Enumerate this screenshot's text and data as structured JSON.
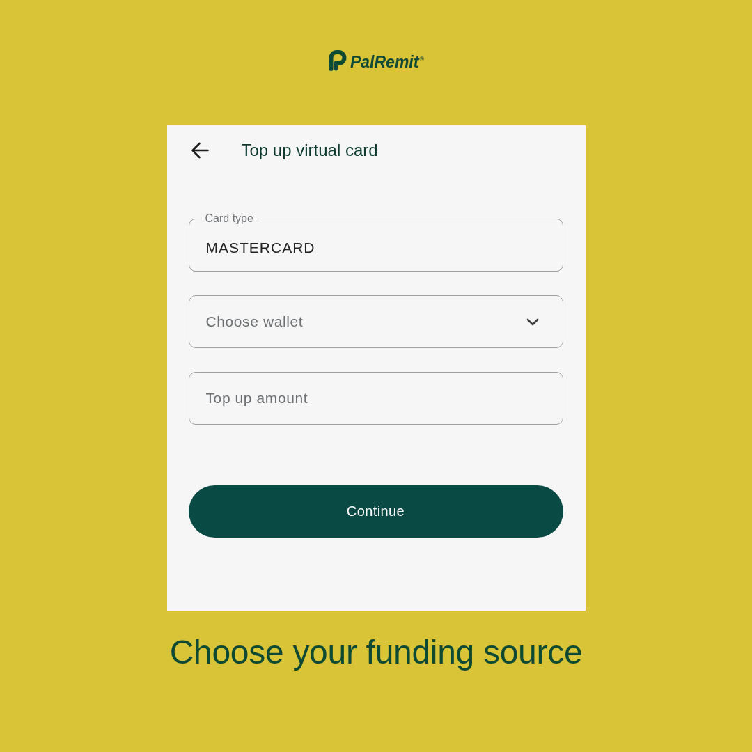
{
  "logo": {
    "text": "PalRemit$^{®}$"
  },
  "screen": {
    "title": "Top up virtual card",
    "fields": [
      {
        "kind": "text",
        "label": "Card type",
        "value": "MASTERCARD"
      },
      {
        "kind": "select",
        "placeholder": "Choose wallet"
      },
      {
        "kind": "text",
        "placeholder": "Top up amount"
      }
    ],
    "button": "Continue"
  },
  "caption": "Choose your funding source"
}
